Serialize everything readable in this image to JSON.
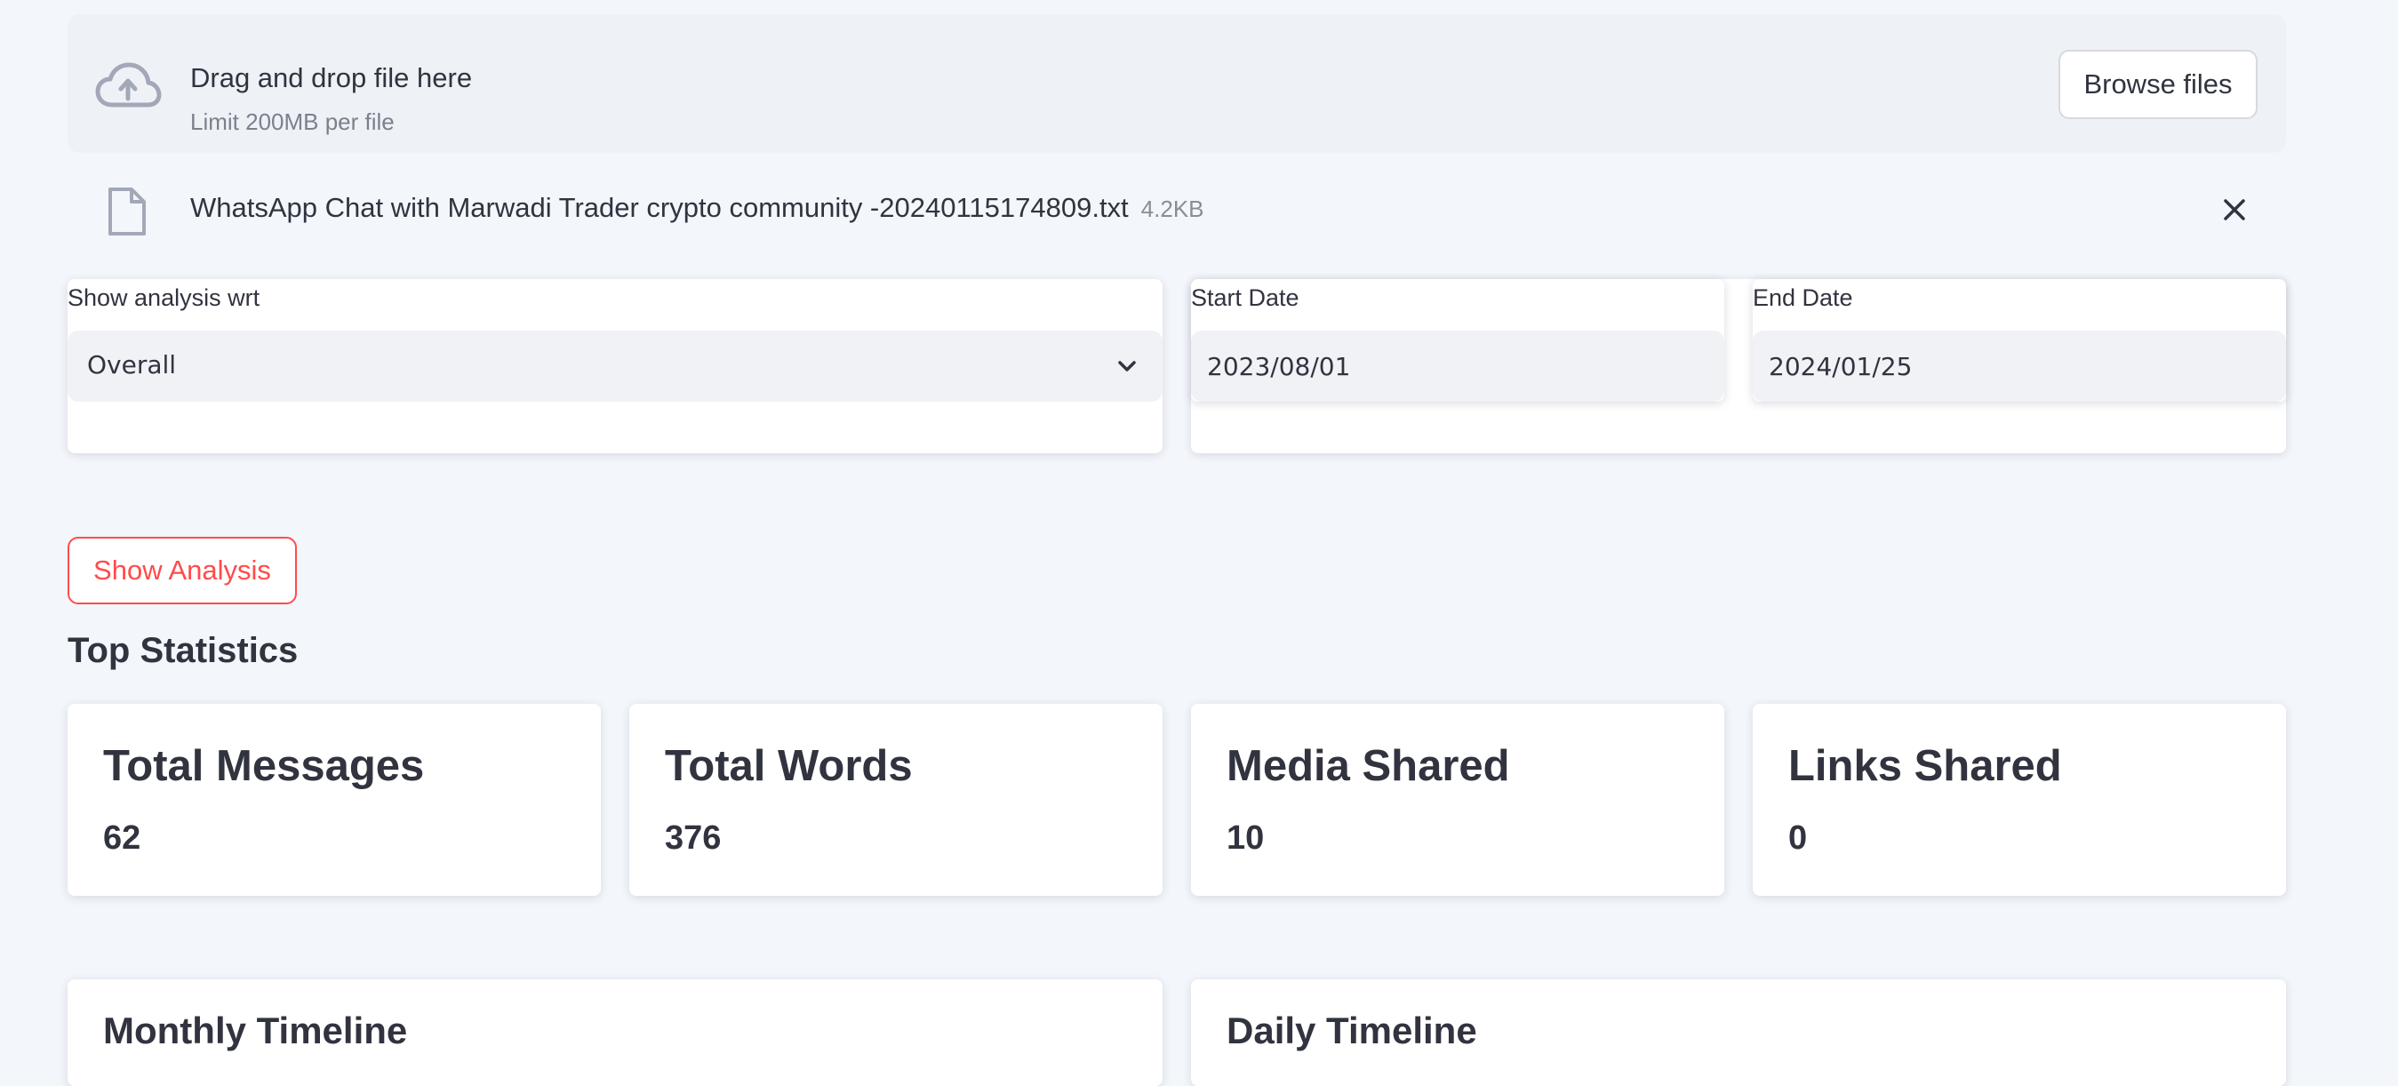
{
  "uploader": {
    "title": "Drag and drop file here",
    "limit": "Limit 200MB per file",
    "browse_label": "Browse files",
    "icon": "cloud-upload-icon"
  },
  "uploaded_file": {
    "name": "WhatsApp Chat with Marwadi Trader crypto community -20240115174809.txt",
    "size": "4.2KB",
    "icon": "file-icon"
  },
  "filters": {
    "analysis_label": "Show analysis wrt",
    "analysis_value": "Overall",
    "start_label": "Start Date",
    "start_value": "2023/08/01",
    "end_label": "End Date",
    "end_value": "2024/01/25"
  },
  "actions": {
    "show_analysis": "Show Analysis"
  },
  "top_statistics": {
    "title": "Top Statistics",
    "cards": [
      {
        "label": "Total Messages",
        "value": "62"
      },
      {
        "label": "Total Words",
        "value": "376"
      },
      {
        "label": "Media Shared",
        "value": "10"
      },
      {
        "label": "Links Shared",
        "value": "0"
      }
    ]
  },
  "timelines": {
    "monthly_title": "Monthly Timeline",
    "daily_title": "Daily Timeline"
  },
  "colors": {
    "page_bg": "#f3f6fb",
    "accent": "#ff4b4b",
    "text": "#31333f",
    "muted": "#7d808c"
  }
}
